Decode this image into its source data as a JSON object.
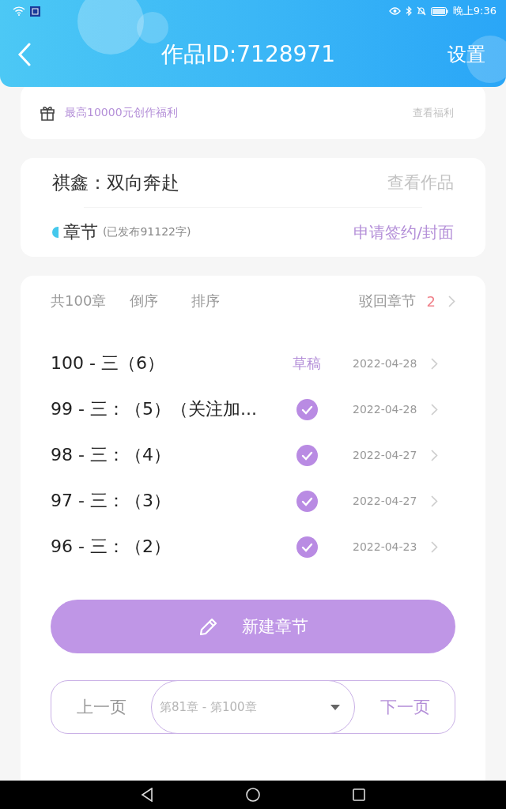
{
  "status_bar": {
    "time": "晚上9:36"
  },
  "header": {
    "title": "作品ID:7128971",
    "action": "设置"
  },
  "welfare": {
    "text": "最高10000元创作福利",
    "link": "查看福利"
  },
  "work": {
    "title": "祺鑫：双向奔赴",
    "link": "查看作品",
    "section": "章节",
    "published": "(已发布91122字)",
    "apply": "申请签约/封面"
  },
  "toolbar": {
    "total": "共100章",
    "items": [
      {
        "label": "倒序",
        "selected": false
      },
      {
        "label": "排序",
        "selected": false
      }
    ],
    "rejected": "驳回章节",
    "rejected_count": "2"
  },
  "chapters": [
    {
      "title": "100 - 三（6）",
      "kind": "draft",
      "status": "草稿",
      "date": "2022-04-28"
    },
    {
      "title": "99 - 三：（5）（关注加...",
      "kind": "published",
      "date": "2022-04-28"
    },
    {
      "title": "98 - 三：（4）",
      "kind": "published",
      "date": "2022-04-27"
    },
    {
      "title": "97 - 三：（3）",
      "kind": "published",
      "date": "2022-04-27"
    },
    {
      "title": "96 - 三：（2）",
      "kind": "published",
      "date": "2022-04-23"
    }
  ],
  "new_button": "新建章节",
  "pager": {
    "prev": "上一页",
    "range": "第81章 - 第100章",
    "next": "下一页"
  }
}
